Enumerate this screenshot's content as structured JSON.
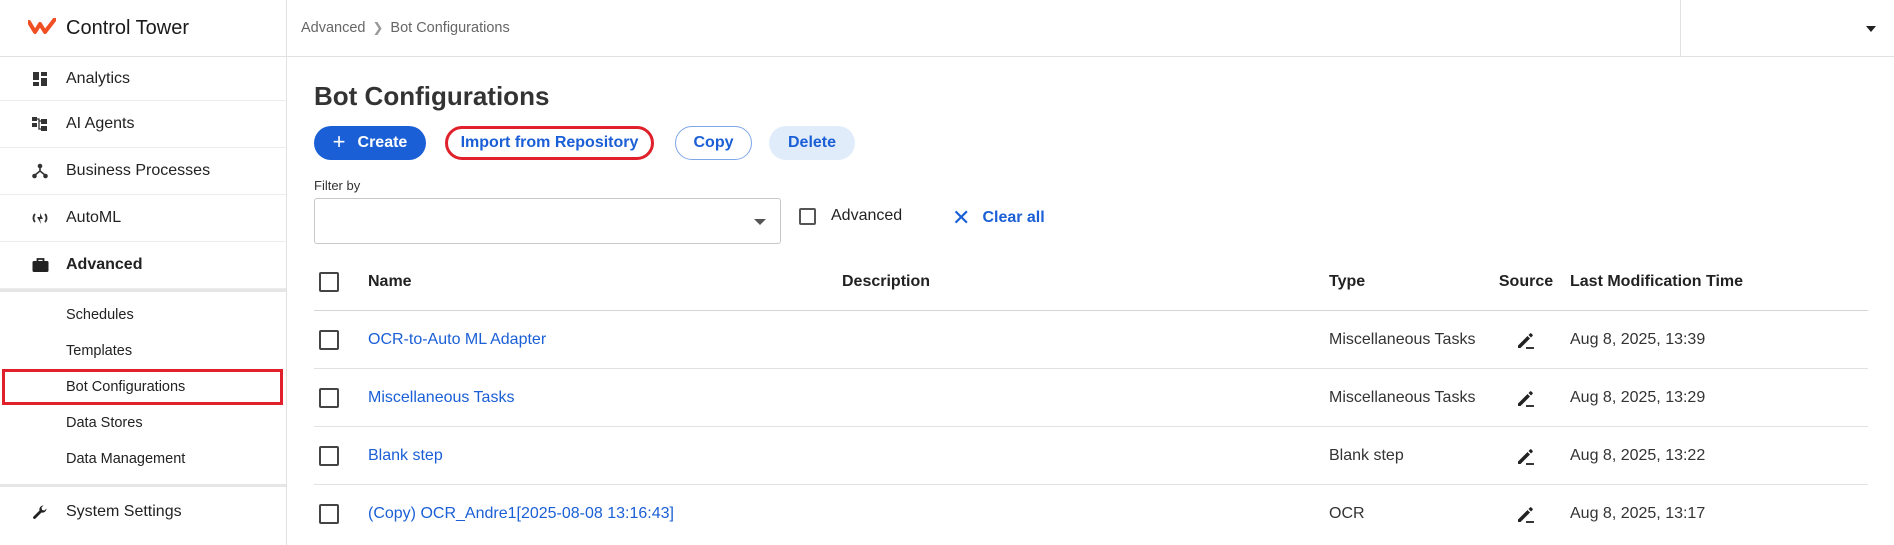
{
  "app": {
    "title": "Control Tower",
    "accent_color": "#1a5fd6",
    "brand_color": "#f04e23"
  },
  "sidebar": {
    "items": [
      {
        "label": "Analytics",
        "icon": "dashboard-icon"
      },
      {
        "label": "AI Agents",
        "icon": "hierarchy-icon"
      },
      {
        "label": "Business Processes",
        "icon": "process-icon"
      },
      {
        "label": "AutoML",
        "icon": "automl-icon"
      },
      {
        "label": "Advanced",
        "icon": "briefcase-icon"
      },
      {
        "label": "System Settings",
        "icon": "wrench-icon"
      }
    ],
    "sub_items": [
      "Schedules",
      "Templates",
      "Bot Configurations",
      "Data Stores",
      "Data Management"
    ]
  },
  "breadcrumb": {
    "parent": "Advanced",
    "current": "Bot Configurations"
  },
  "page": {
    "title": "Bot Configurations"
  },
  "toolbar": {
    "create": "Create",
    "import": "Import from Repository",
    "copy": "Copy",
    "delete": "Delete"
  },
  "filter": {
    "label": "Filter by",
    "advanced": "Advanced",
    "clear_all": "Clear all"
  },
  "table": {
    "columns": {
      "name": "Name",
      "description": "Description",
      "type": "Type",
      "source": "Source",
      "time": "Last Modification Time"
    },
    "rows": [
      {
        "name": "OCR-to-Auto ML Adapter",
        "description": "",
        "type": "Miscellaneous Tasks",
        "time": "Aug 8, 2025, 13:39"
      },
      {
        "name": "Miscellaneous Tasks",
        "description": "",
        "type": "Miscellaneous Tasks",
        "time": "Aug 8, 2025, 13:29"
      },
      {
        "name": "Blank step",
        "description": "",
        "type": "Blank step",
        "time": "Aug 8, 2025, 13:22"
      },
      {
        "name": "(Copy) OCR_Andre1[2025-08-08 13:16:43]",
        "description": "",
        "type": "OCR",
        "time": "Aug 8, 2025, 13:17"
      }
    ]
  }
}
